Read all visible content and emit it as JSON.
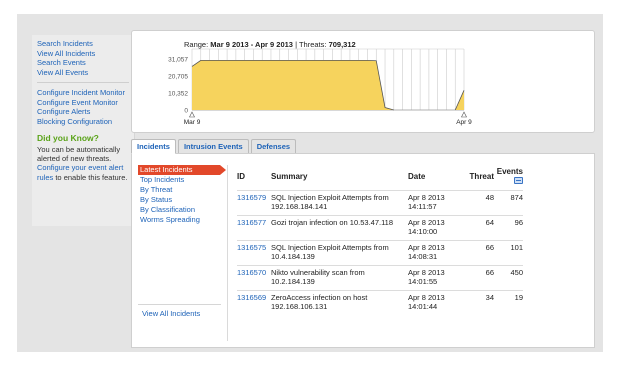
{
  "sidebar": {
    "links_top": [
      "Search Incidents",
      "View All Incidents",
      "Search Events",
      "View All Events"
    ],
    "links_config": [
      "Configure Incident Monitor",
      "Configure Event Monitor",
      "Configure Alerts",
      "Blocking Configuration"
    ],
    "dyk_title": "Did you Know?",
    "dyk_text_before": "You can be automatically alerted of new threats. ",
    "dyk_link": "Configure your event alert rules",
    "dyk_text_after": " to enable this feature."
  },
  "chart": {
    "range_label": "Range:",
    "range_value": "Mar 9 2013 - Apr 9 2013",
    "threats_label": "| Threats:",
    "threats_value": "709,312",
    "fill_color": "#f6d35d",
    "stroke_color": "#555555"
  },
  "chart_data": {
    "type": "area",
    "title": "",
    "xlabel": "",
    "ylabel": "",
    "y_ticks": [
      "0",
      "10,352",
      "20,705",
      "31,057"
    ],
    "ylim": [
      0,
      31057
    ],
    "x_ticks": [
      "Mar 9",
      "Apr 9"
    ],
    "x": [
      "Mar 9",
      "Mar 10",
      "Mar 11",
      "Mar 12",
      "Mar 13",
      "Mar 14",
      "Mar 15",
      "Mar 16",
      "Mar 17",
      "Mar 18",
      "Mar 19",
      "Mar 20",
      "Mar 21",
      "Mar 22",
      "Mar 23",
      "Mar 24",
      "Mar 25",
      "Mar 26",
      "Mar 27",
      "Mar 28",
      "Mar 29",
      "Mar 30",
      "Mar 31",
      "Apr 1",
      "Apr 2",
      "Apr 3",
      "Apr 4",
      "Apr 5",
      "Apr 6",
      "Apr 7",
      "Apr 8",
      "Apr 9"
    ],
    "values": [
      26500,
      30200,
      30200,
      30200,
      30200,
      30200,
      30200,
      30200,
      30200,
      30200,
      30200,
      30200,
      30200,
      30200,
      30200,
      30200,
      30200,
      30200,
      30200,
      30200,
      30200,
      30000,
      1500,
      0,
      0,
      0,
      0,
      0,
      0,
      0,
      0,
      12000
    ],
    "grid": true
  },
  "tabs": [
    "Incidents",
    "Intrusion Events",
    "Defenses"
  ],
  "subnav": {
    "items": [
      "Latest Incidents",
      "Top Incidents",
      "By Threat",
      "By Status",
      "By Classification",
      "Worms Spreading"
    ],
    "view_all": "View All Incidents"
  },
  "table": {
    "headers": {
      "id": "ID",
      "summary": "Summary",
      "date": "Date",
      "threat": "Threat",
      "events": "Events"
    },
    "rows": [
      {
        "id": "1316579",
        "summary": "SQL Injection Exploit Attempts from 192.168.184.141",
        "date": "Apr 8 2013 14:11:57",
        "threat": "48",
        "events": "874"
      },
      {
        "id": "1316577",
        "summary": "Gozi trojan infection on 10.53.47.118",
        "date": "Apr 8 2013 14:10:00",
        "threat": "64",
        "events": "96"
      },
      {
        "id": "1316575",
        "summary": "SQL Injection Exploit Attempts from 10.4.184.139",
        "date": "Apr 8 2013 14:08:31",
        "threat": "66",
        "events": "101"
      },
      {
        "id": "1316570",
        "summary": "Nikto vulnerability scan from 10.2.184.139",
        "date": "Apr 8 2013 14:01:55",
        "threat": "66",
        "events": "450"
      },
      {
        "id": "1316569",
        "summary": "ZeroAccess infection on host 192.168.106.131",
        "date": "Apr 8 2013 14:01:44",
        "threat": "34",
        "events": "19"
      }
    ]
  }
}
